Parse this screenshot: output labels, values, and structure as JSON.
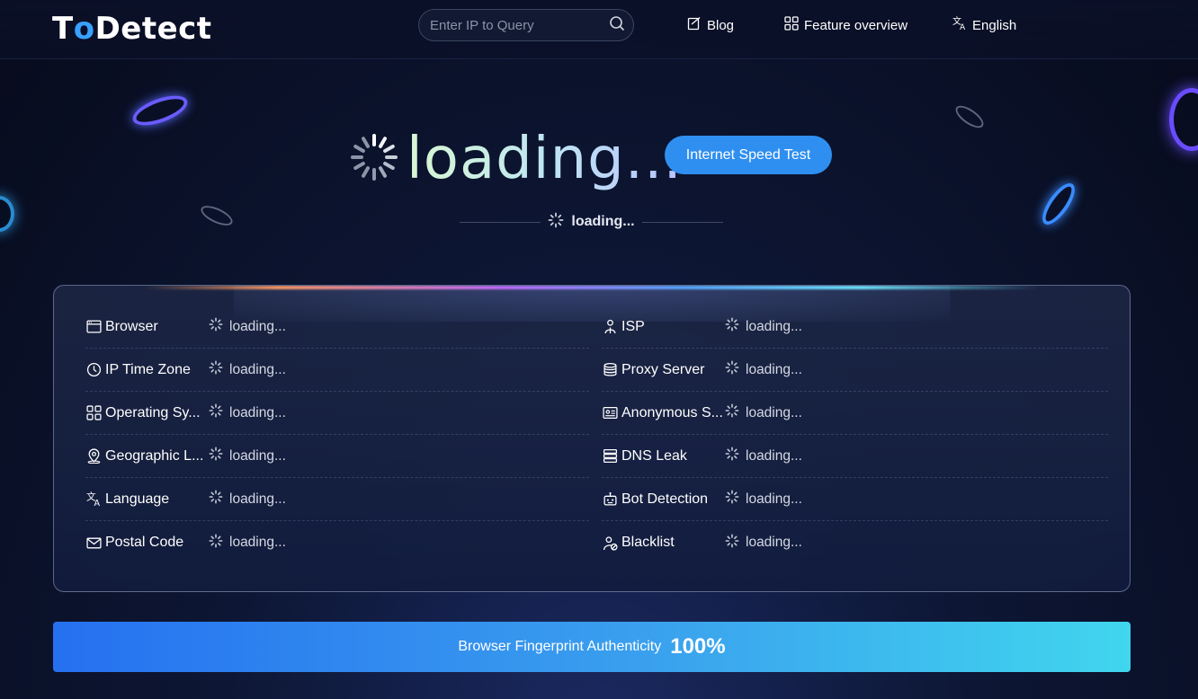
{
  "header": {
    "logo_text_a": "T",
    "logo_text_o": "o",
    "logo_text_b": " Detect",
    "search_placeholder": "Enter IP to Query",
    "nav": {
      "blog": "Blog",
      "features": "Feature overview",
      "language": "English"
    }
  },
  "hero": {
    "title": "loading...",
    "speed_button": "Internet Speed Test",
    "subtitle": "loading..."
  },
  "info": {
    "left": [
      {
        "label": "Browser",
        "icon": "browser-window-icon",
        "value": "loading..."
      },
      {
        "label": "IP Time Zone",
        "icon": "clock-icon",
        "value": "loading..."
      },
      {
        "label": "Operating Sy...",
        "icon": "grid-apps-icon",
        "value": "loading..."
      },
      {
        "label": "Geographic L...",
        "icon": "map-pin-icon",
        "value": "loading..."
      },
      {
        "label": "Language",
        "icon": "translate-icon",
        "value": "loading..."
      },
      {
        "label": "Postal Code",
        "icon": "envelope-icon",
        "value": "loading..."
      }
    ],
    "right": [
      {
        "label": "ISP",
        "icon": "user-network-icon",
        "value": "loading..."
      },
      {
        "label": "Proxy Server",
        "icon": "database-icon",
        "value": "loading..."
      },
      {
        "label": "Anonymous S...",
        "icon": "id-card-icon",
        "value": "loading..."
      },
      {
        "label": "DNS Leak",
        "icon": "server-stack-icon",
        "value": "loading..."
      },
      {
        "label": "Bot Detection",
        "icon": "robot-icon",
        "value": "loading..."
      },
      {
        "label": "Blacklist",
        "icon": "user-block-icon",
        "value": "loading..."
      }
    ]
  },
  "footer": {
    "label": "Browser Fingerprint Authenticity",
    "value": "100%"
  }
}
